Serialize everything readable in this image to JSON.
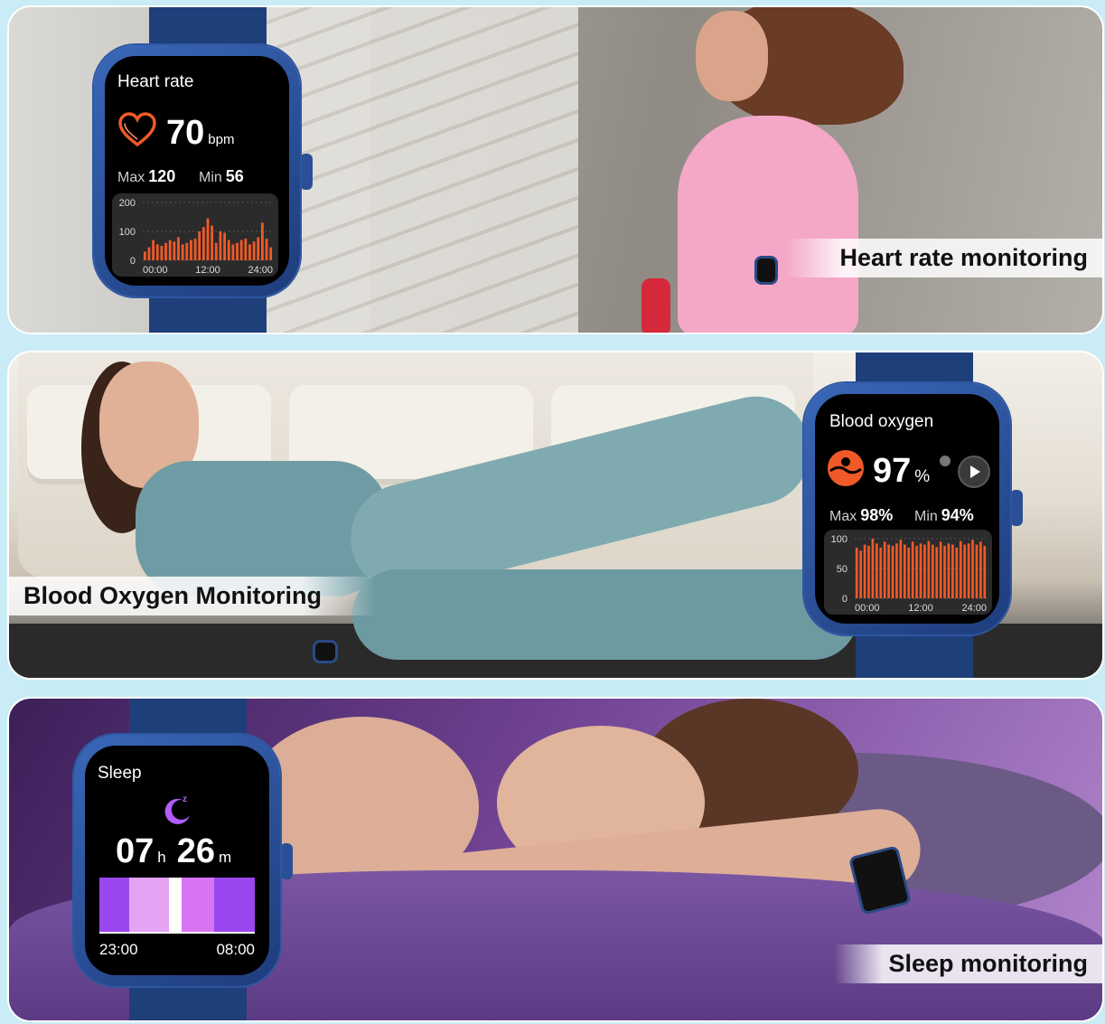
{
  "panels": [
    {
      "caption": "Heart rate monitoring"
    },
    {
      "caption": "Blood Oxygen Monitoring"
    },
    {
      "caption": "Sleep monitoring"
    }
  ],
  "heart_rate_watch": {
    "title": "Heart rate",
    "value": "70",
    "unit": "bpm",
    "max_label": "Max",
    "max_value": "120",
    "min_label": "Min",
    "min_value": "56",
    "icon": "heart-outline-icon",
    "accent": "#f05a28"
  },
  "blood_oxygen_watch": {
    "title": "Blood oxygen",
    "value": "97",
    "unit": "%",
    "max_label": "Max",
    "max_value": "98%",
    "min_label": "Min",
    "min_value": "94%",
    "icon": "sunset-icon",
    "accent": "#f05a28"
  },
  "sleep_watch": {
    "title": "Sleep",
    "hours": "07",
    "hours_unit": "h",
    "minutes": "26",
    "minutes_unit": "m",
    "start_time": "23:00",
    "end_time": "08:00",
    "icon": "moon-icon",
    "accent": "#b15cff",
    "stages": [
      0.19,
      0.26,
      0.08,
      0.21,
      0.26
    ],
    "stage_colors": [
      "#9b47f0",
      "#e4a4f3",
      "#ffffff",
      "#d874f2",
      "#9b47f0"
    ]
  },
  "chart_data": [
    {
      "type": "bar",
      "title": "Heart rate",
      "yticks": [
        "200",
        "100",
        "0"
      ],
      "xticks": [
        "00:00",
        "12:00",
        "24:00"
      ],
      "ylim": [
        0,
        200
      ],
      "values": [
        30,
        45,
        70,
        55,
        50,
        60,
        70,
        65,
        80,
        55,
        60,
        70,
        75,
        100,
        115,
        145,
        120,
        60,
        100,
        95,
        70,
        55,
        60,
        70,
        75,
        55,
        65,
        80,
        130,
        75,
        45
      ]
    },
    {
      "type": "bar",
      "title": "Blood oxygen",
      "yticks": [
        "100",
        "50",
        "0"
      ],
      "xticks": [
        "00:00",
        "12:00",
        "24:00"
      ],
      "ylim": [
        0,
        100
      ],
      "values": [
        85,
        80,
        90,
        88,
        100,
        92,
        85,
        95,
        90,
        88,
        92,
        98,
        90,
        85,
        95,
        88,
        92,
        90,
        96,
        90,
        86,
        95,
        88,
        92,
        90,
        85,
        96,
        90,
        92,
        98,
        90,
        95,
        88
      ]
    }
  ]
}
